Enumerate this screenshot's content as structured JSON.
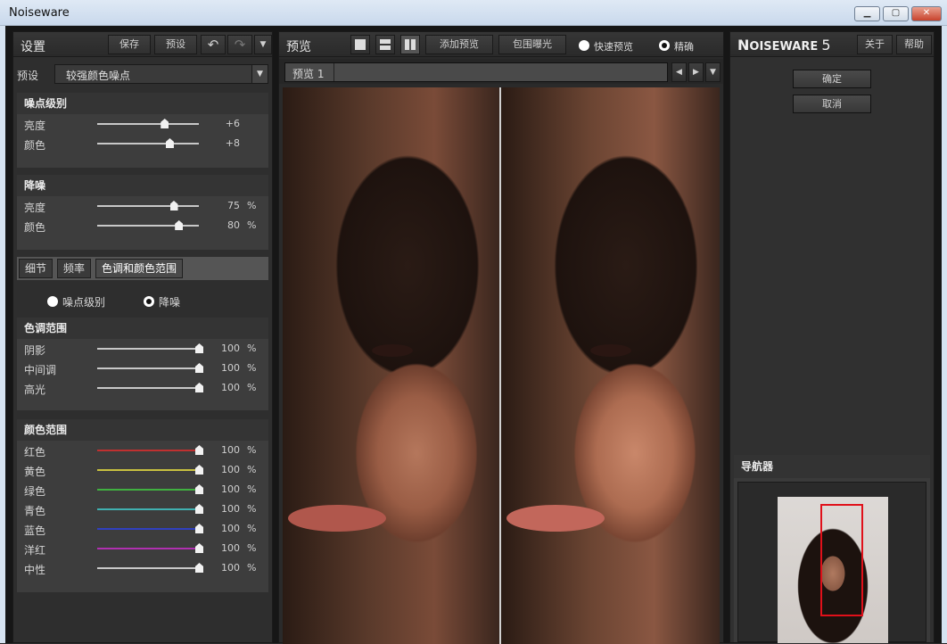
{
  "window": {
    "title": "Noiseware"
  },
  "settings": {
    "title": "设置",
    "save": "保存",
    "preset_button": "预设",
    "preset_label": "预设",
    "preset_value": "较强颜色噪点",
    "noise_level": {
      "title": "噪点级别",
      "rows": [
        {
          "label": "亮度",
          "value": "+6",
          "fraction": 0.66
        },
        {
          "label": "颜色",
          "value": "+8",
          "fraction": 0.71
        }
      ]
    },
    "denoise": {
      "title": "降噪",
      "rows": [
        {
          "label": "亮度",
          "value": "75",
          "unit": "%",
          "fraction": 0.75
        },
        {
          "label": "颜色",
          "value": "80",
          "unit": "%",
          "fraction": 0.8
        }
      ]
    },
    "tabs": [
      "细节",
      "频率",
      "色调和颜色范围"
    ],
    "radios": [
      "噪点级别",
      "降噪"
    ],
    "tone_range": {
      "title": "色调范围",
      "rows": [
        {
          "label": "阴影",
          "value": "100",
          "unit": "%",
          "color": "#c8c8c8"
        },
        {
          "label": "中间调",
          "value": "100",
          "unit": "%",
          "color": "#c8c8c8"
        },
        {
          "label": "高光",
          "value": "100",
          "unit": "%",
          "color": "#c8c8c8"
        }
      ]
    },
    "color_range": {
      "title": "颜色范围",
      "rows": [
        {
          "label": "红色",
          "value": "100",
          "unit": "%",
          "color": "#c03030"
        },
        {
          "label": "黄色",
          "value": "100",
          "unit": "%",
          "color": "#c8c040"
        },
        {
          "label": "绿色",
          "value": "100",
          "unit": "%",
          "color": "#40b040"
        },
        {
          "label": "青色",
          "value": "100",
          "unit": "%",
          "color": "#40b0b0"
        },
        {
          "label": "蓝色",
          "value": "100",
          "unit": "%",
          "color": "#3040c0"
        },
        {
          "label": "洋红",
          "value": "100",
          "unit": "%",
          "color": "#b030b0"
        },
        {
          "label": "中性",
          "value": "100",
          "unit": "%",
          "color": "#c8c8c8"
        }
      ]
    }
  },
  "preview": {
    "title": "预览",
    "add_preview": "添加预览",
    "bracket": "包围曝光",
    "fast_preview": "快速预览",
    "accurate": "精确",
    "tab": "预览 1"
  },
  "right": {
    "logo_big": "N",
    "logo_small": "OISEWARE",
    "logo_num": "5",
    "about": "关于",
    "help": "帮助",
    "ok": "确定",
    "cancel": "取消",
    "navigator": "导航器"
  }
}
